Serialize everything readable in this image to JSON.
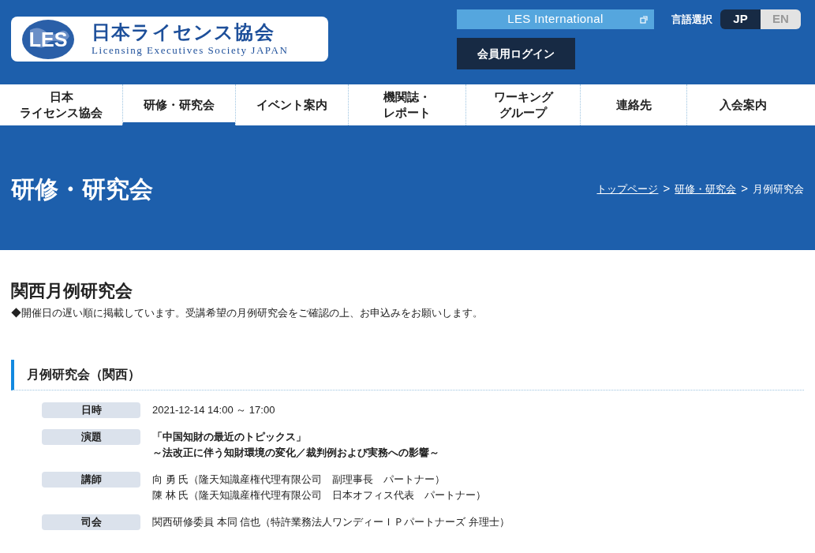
{
  "logo": {
    "badge": "LES",
    "name": "日本ライセンス協会",
    "subtitle": "Licensing Executives Society JAPAN"
  },
  "header": {
    "international_link": "LES International",
    "login_button": "会員用ログイン",
    "language_label": "言語選択",
    "languages": [
      {
        "label": "JP",
        "selected": true
      },
      {
        "label": "EN",
        "selected": false
      }
    ]
  },
  "nav": [
    {
      "lines": [
        "日本",
        "ライセンス協会"
      ],
      "selected": false
    },
    {
      "lines": [
        "研修・研究会"
      ],
      "selected": true
    },
    {
      "lines": [
        "イベント案内"
      ],
      "selected": false
    },
    {
      "lines": [
        "機関誌・",
        "レポート"
      ],
      "selected": false
    },
    {
      "lines": [
        "ワーキング",
        "グループ"
      ],
      "selected": false
    },
    {
      "lines": [
        "連絡先"
      ],
      "selected": false
    },
    {
      "lines": [
        "入会案内"
      ],
      "selected": false
    }
  ],
  "hero": {
    "title": "研修・研究会",
    "breadcrumb": [
      {
        "label": "トップページ",
        "kind": "link"
      },
      {
        "label": ">",
        "kind": "separator"
      },
      {
        "label": "研修・研究会",
        "kind": "link"
      },
      {
        "label": ">",
        "kind": "separator"
      },
      {
        "label": "月例研究会",
        "kind": "current"
      }
    ]
  },
  "page": {
    "title": "関西月例研究会",
    "notice": "◆開催日の遅い順に掲載しています。受講希望の月例研究会をご確認の上、お申込みをお願いします。"
  },
  "section": {
    "heading": "月例研究会（関西）",
    "rows": [
      {
        "label": "日時",
        "bold": false,
        "lines": [
          "2021-12-14 14:00 ～ 17:00"
        ]
      },
      {
        "label": "演題",
        "bold": true,
        "lines": [
          "「中国知財の最近のトピックス」",
          "～法改正に伴う知財環境の変化／裁判例および実務への影響～"
        ]
      },
      {
        "label": "講師",
        "bold": false,
        "lines": [
          "向 勇 氏（隆天知識産権代理有限公司　副理事長　パートナー）",
          "陳 林 氏（隆天知識産権代理有限公司　日本オフィス代表　パートナー）"
        ]
      },
      {
        "label": "司会",
        "bold": false,
        "lines": [
          "関西研修委員 本同 信也（特許業務法人ワンディーＩＰパートナーズ 弁理士）"
        ]
      }
    ]
  }
}
